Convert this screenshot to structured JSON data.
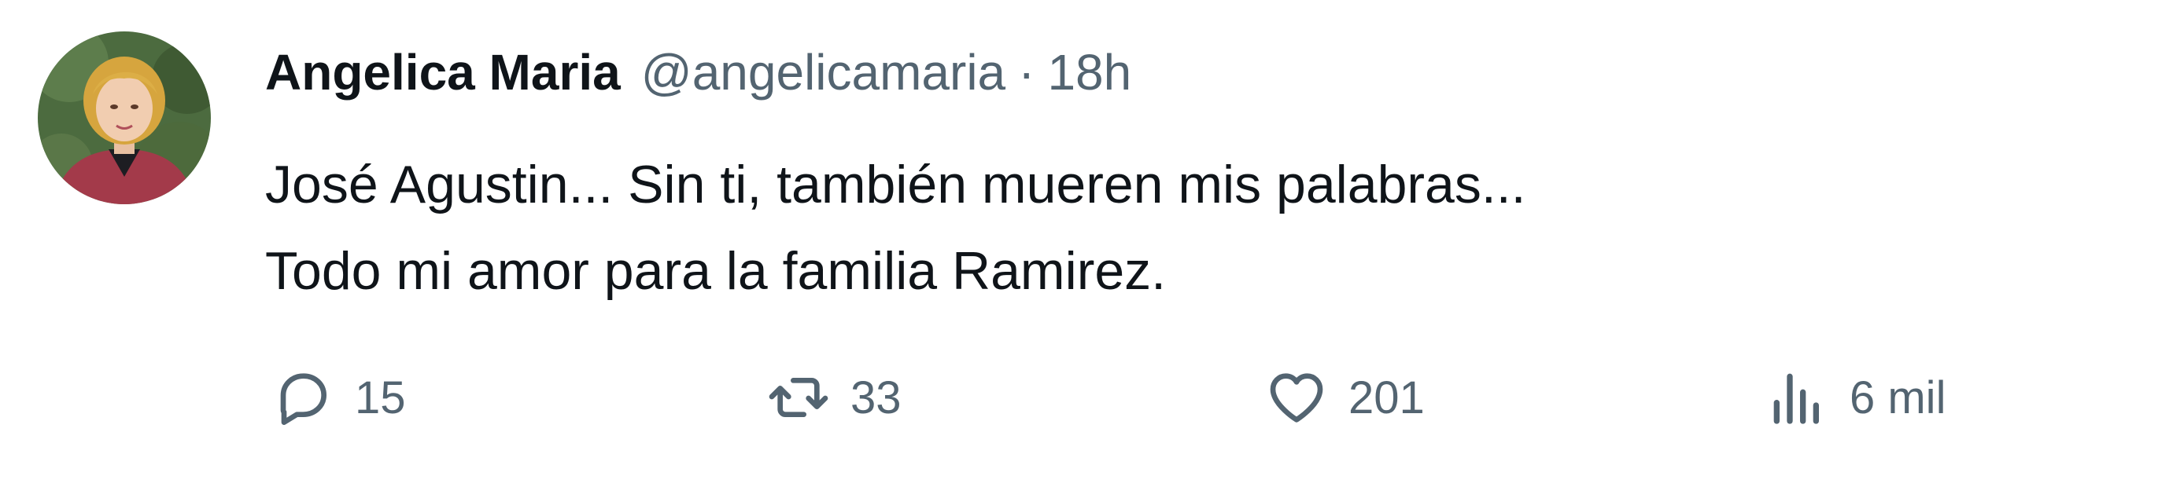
{
  "author": {
    "display_name": "Angelica Maria",
    "handle": "@angelicamaria",
    "separator": "·",
    "time_ago": "18h"
  },
  "tweet": {
    "lines": [
      "José Agustin... Sin ti, también mueren mis palabras...",
      "Todo mi amor para la familia Ramirez."
    ]
  },
  "actions": {
    "reply": {
      "icon": "reply-icon",
      "count": "15"
    },
    "retweet": {
      "icon": "retweet-icon",
      "count": "33"
    },
    "like": {
      "icon": "heart-icon",
      "count": "201"
    },
    "views": {
      "icon": "views-icon",
      "count": "6 mil"
    }
  },
  "colors": {
    "primary_text": "#0f1419",
    "secondary_text": "#536471",
    "background": "#ffffff"
  }
}
